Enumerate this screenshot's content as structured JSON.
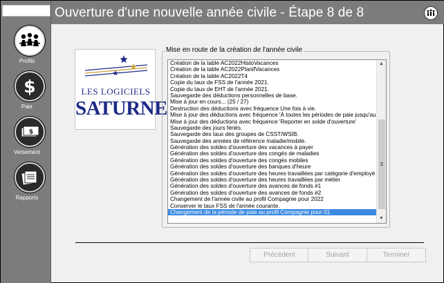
{
  "window": {
    "title": "Ouverture d'une nouvelle année civile - Étape 8 de 8"
  },
  "sidebar": {
    "items": [
      {
        "label": "Profils",
        "icon": "people-icon"
      },
      {
        "label": "Paie",
        "icon": "dollar-icon"
      },
      {
        "label": "Versement",
        "icon": "money-icon"
      },
      {
        "label": "Rapports",
        "icon": "reports-icon"
      }
    ]
  },
  "logo": {
    "line1": "LES LOGICIELS",
    "line2": "SATURNE"
  },
  "group": {
    "legend": "Mise en route de la création de l'année civile"
  },
  "log": {
    "items": [
      "Création de la table AC2022HistoVacances",
      "Création de la table AC2022PlanifVacances",
      "Création de la table AC2022T4",
      "Copie du taux de FSS de l'année 2021.",
      "Copie du taux de EHT de l'année 2021.",
      "Sauvegarde des déductions personnelles de base.",
      "Mise à jour en cours... (25 / 27)",
      "Destruction des déductions avec fréquence Une fois à vie.",
      "Mise à jour des déductions avec fréquence 'À toutes les périodes de paie jusqu'au m",
      "Mise à jour des déductions avec fréquence 'Reporter en solde d'ouverture'",
      "Sauvegarde des jours fériés.",
      "Sauvegarde des taux des groupes de CSST/WSIB.",
      "Sauvegarde des années de référence maladie/mobile.",
      "Génération des soldes d'ouverture des vacances à payer",
      "Génération des soldes d'ouverture des congés de maladies",
      "Génération des soldes d'ouverture des congés mobiles",
      "Génération des soldes d'ouverture des banques d'heure",
      "Génération des soldes d'ouverture des heures travaillées par catégorie d'employé",
      "Génération des soldes d'ouverture des heures travaillées par métier",
      "Génération des soldes d'ouverture des avances de fonds #1",
      "Génération des soldes d'ouverture des avances de fonds #2",
      "Changement de l'année civile au profil Compagnie pour 2022",
      "Conserver le taux FSS de l'année courante.",
      "Changement de la période de paie au profil Compagnie pour 01"
    ],
    "selected_index": 23
  },
  "buttons": {
    "previous": "Précédent",
    "next": "Suivant",
    "finish": "Terminer"
  },
  "colors": {
    "chrome": "#7c7c7c",
    "selection": "#3c8ae0",
    "logo_blue": "#1c2a86",
    "logo_gold": "#c8a032"
  }
}
